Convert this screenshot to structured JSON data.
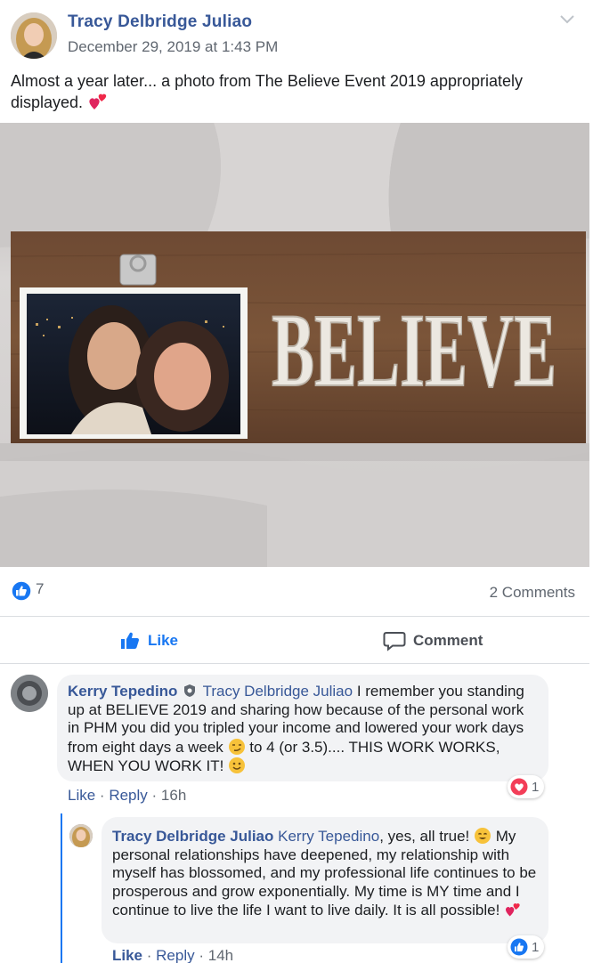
{
  "post": {
    "author": "Tracy Delbridge Juliao",
    "timestamp": "December 29, 2019 at 1:43 PM",
    "text": "Almost a year later... a photo from The Believe Event 2019 appropriately displayed.",
    "photo_sign_text": "BELIEVE",
    "like_count": "7",
    "comments_label": "2 Comments"
  },
  "actions": {
    "like_label": "Like",
    "comment_label": "Comment"
  },
  "comments": [
    {
      "author": "Kerry Tepedino",
      "mention": "Tracy Delbridge Juliao",
      "text_1": "I remember you standing up at BELIEVE 2019 and sharing how because of the personal work in PHM you did you tripled your income and lowered your work days from eight days a week",
      "text_2": "to 4 (or 3.5).... THIS WORK WORKS, WHEN YOU WORK IT!",
      "like_label": "Like",
      "reply_label": "Reply",
      "time": "16h",
      "reaction_count": "1"
    },
    {
      "author": "Tracy Delbridge Juliao",
      "mention": "Kerry Tepedino",
      "text_1": ", yes, all true!",
      "text_2": "My personal relationships have deepened, my relationship with myself has blossomed, and my professional life continues to be prosperous and grow exponentially. My time is MY time and I continue to live the life I want to live daily. It is all possible!",
      "like_label": "Like",
      "reply_label": "Reply",
      "time": "14h",
      "reaction_count": "1"
    }
  ],
  "colors": {
    "link": "#385898",
    "accent": "#1877f2",
    "muted": "#606770",
    "bubble": "#f2f3f5"
  }
}
